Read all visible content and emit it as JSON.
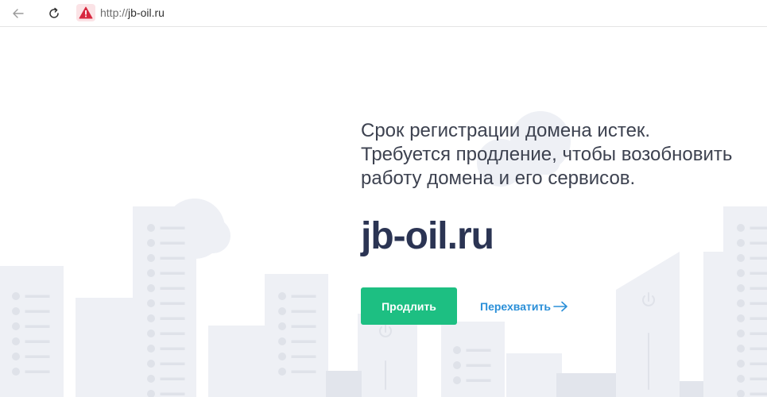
{
  "browser": {
    "url_scheme": "http://",
    "url_host": "jb-oil.ru",
    "back_icon": "arrow-left-icon",
    "reload_icon": "reload-icon",
    "security_icon": "warning-triangle-icon"
  },
  "main": {
    "message_lines": [
      "Срок регистрации домена истек.",
      "Требуется продление, чтобы возобновить",
      "работу домена и его сервисов."
    ],
    "domain": "jb-oil.ru",
    "renew_label": "Продлить",
    "intercept_label": "Перехватить"
  },
  "colors": {
    "accent_green": "#1dbf82",
    "link_blue": "#2a8fd8",
    "warning_red": "#d7283f",
    "domain_text": "#2b3453",
    "skyline": "#eef0f5"
  }
}
